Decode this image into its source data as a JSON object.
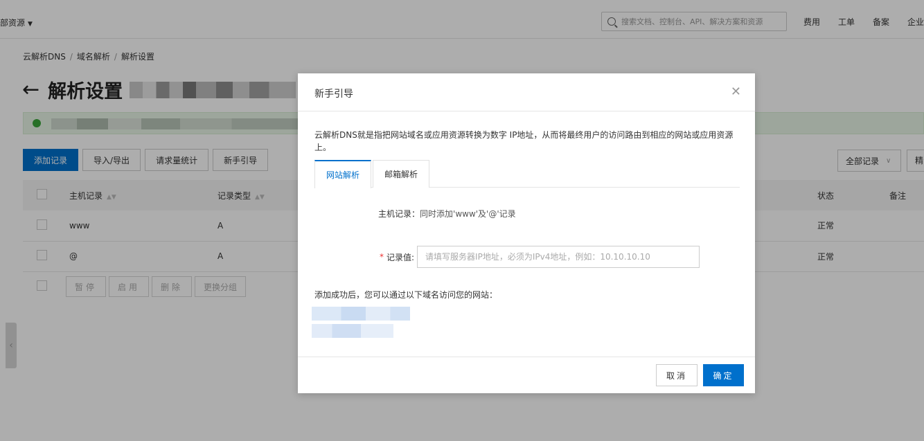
{
  "topbar": {
    "resource_label": "部资源",
    "search_placeholder": "搜索文档、控制台、API、解决方案和资源",
    "nav": [
      "费用",
      "工单",
      "备案",
      "企业"
    ]
  },
  "breadcrumb": [
    "云解析DNS",
    "域名解析",
    "解析设置"
  ],
  "page_title": "解析设置",
  "toolbar": {
    "buttons": [
      "添加记录",
      "导入/导出",
      "请求量统计",
      "新手引导"
    ],
    "filter_select": "全部记录",
    "right_button": "精"
  },
  "table": {
    "headers": [
      "主机记录",
      "记录类型",
      "状态",
      "备注"
    ],
    "rows": [
      {
        "host": "www",
        "type": "A",
        "status": "正常"
      },
      {
        "host": "@",
        "type": "A",
        "status": "正常"
      }
    ],
    "batch_actions": [
      "暂停",
      "启用",
      "删除",
      "更换分组"
    ]
  },
  "modal": {
    "title": "新手引导",
    "intro": "云解析DNS就是指把网站域名或应用资源转换为数字 IP地址，从而将最终用户的访问路由到相应的网站或应用资源上。",
    "tabs": [
      "网站解析",
      "邮箱解析"
    ],
    "active_tab": "网站解析",
    "host_label": "主机记录：",
    "host_value": "同时添加'www'及'@'记录",
    "record_label": "记录值:",
    "record_placeholder": "请填写服务器IP地址，必须为IPv4地址，例如：10.10.10.10",
    "success_text": "添加成功后，您可以通过以下域名访问您的网站：",
    "cancel": "取消",
    "ok": "确定"
  },
  "colors": {
    "primary": "#0070cc",
    "status_ok": "#1e8e3e",
    "required": "#ee3333"
  }
}
